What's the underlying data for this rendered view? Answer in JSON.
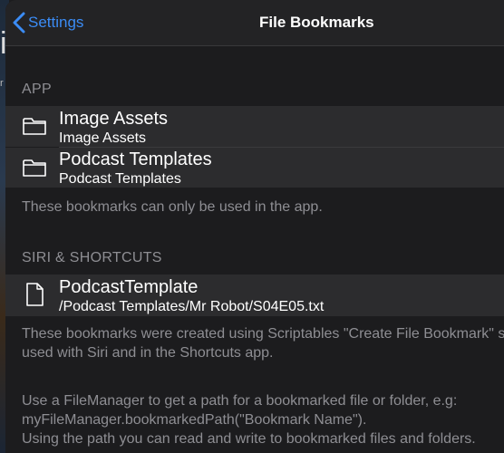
{
  "nav": {
    "back_label": "Settings",
    "title": "File Bookmarks"
  },
  "backdrop": {
    "glyph_a": "i",
    "glyph_b": "r"
  },
  "sections": {
    "app": {
      "header": "APP",
      "rows": [
        {
          "title": "Image Assets",
          "subtitle": "Image Assets",
          "icon": "folder-icon"
        },
        {
          "title": "Podcast Templates",
          "subtitle": "Podcast Templates",
          "icon": "folder-icon"
        }
      ],
      "footer": "These bookmarks can only be used in the app."
    },
    "siri": {
      "header": "SIRI & SHORTCUTS",
      "rows": [
        {
          "title": "PodcastTemplate",
          "subtitle": "/Podcast Templates/Mr Robot/S04E05.txt",
          "icon": "file-icon"
        }
      ],
      "footer_lines": [
        "These bookmarks were created using Scriptables \"Create File Bookmark\" shortcut and can be",
        "used with Siri and in the Shortcuts app.",
        "",
        "Use a FileManager to get a path for a bookmarked file or folder, e.g:",
        "myFileManager.bookmarkedPath(\"Bookmark Name\").",
        "Using the path you can read and write to bookmarked files and folders."
      ]
    }
  },
  "colors": {
    "accent": "#3b8cf5",
    "background": "#1c1c1e",
    "cell": "#2c2c2e",
    "secondary_text": "#8e8e93"
  }
}
